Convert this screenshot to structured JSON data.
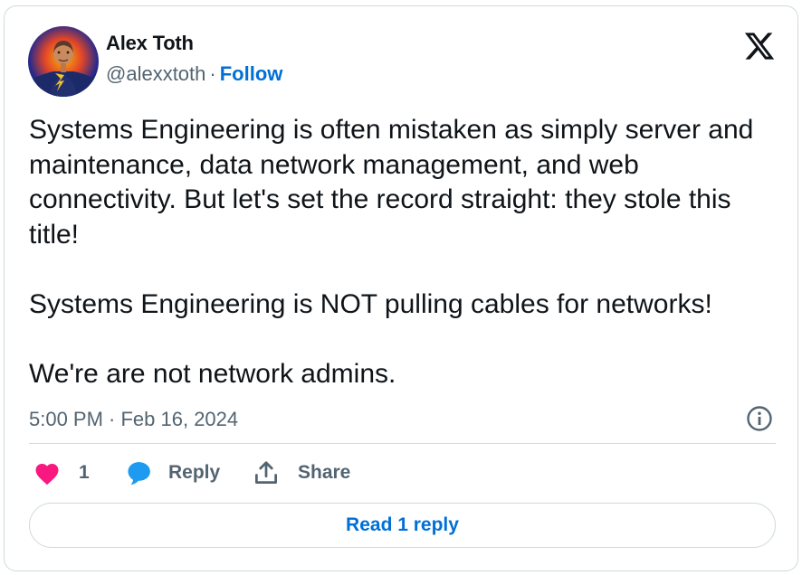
{
  "author": {
    "name": "Alex Toth",
    "handle": "@alexxtoth",
    "separator": "·",
    "follow_label": "Follow"
  },
  "tweet": {
    "paragraphs": [
      "Systems Engineering is often mistaken as simply server and maintenance, data network management, and web connectivity. But let's set the record straight: they stole this title!",
      "Systems Engineering is NOT pulling cables for networks!",
      "We're are not network admins."
    ],
    "timestamp": "5:00 PM · Feb 16, 2024"
  },
  "actions": {
    "like_count": "1",
    "reply_label": "Reply",
    "share_label": "Share"
  },
  "read_replies_label": "Read 1 reply",
  "colors": {
    "link": "#006fd6",
    "like": "#f91880",
    "reply": "#1d9bf0",
    "muted": "#536471",
    "border": "#cfd9de"
  },
  "icons": [
    "x-logo-icon",
    "info-icon",
    "heart-icon",
    "reply-bubble-icon",
    "share-icon"
  ]
}
